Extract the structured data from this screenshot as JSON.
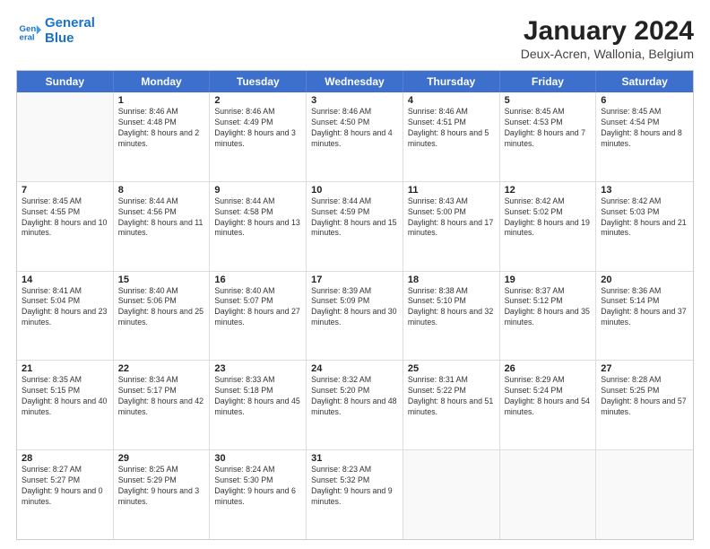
{
  "logo": {
    "line1": "General",
    "line2": "Blue"
  },
  "title": "January 2024",
  "subtitle": "Deux-Acren, Wallonia, Belgium",
  "header_days": [
    "Sunday",
    "Monday",
    "Tuesday",
    "Wednesday",
    "Thursday",
    "Friday",
    "Saturday"
  ],
  "rows": [
    [
      {
        "num": "",
        "sunrise": "",
        "sunset": "",
        "daylight": ""
      },
      {
        "num": "1",
        "sunrise": "Sunrise: 8:46 AM",
        "sunset": "Sunset: 4:48 PM",
        "daylight": "Daylight: 8 hours and 2 minutes."
      },
      {
        "num": "2",
        "sunrise": "Sunrise: 8:46 AM",
        "sunset": "Sunset: 4:49 PM",
        "daylight": "Daylight: 8 hours and 3 minutes."
      },
      {
        "num": "3",
        "sunrise": "Sunrise: 8:46 AM",
        "sunset": "Sunset: 4:50 PM",
        "daylight": "Daylight: 8 hours and 4 minutes."
      },
      {
        "num": "4",
        "sunrise": "Sunrise: 8:46 AM",
        "sunset": "Sunset: 4:51 PM",
        "daylight": "Daylight: 8 hours and 5 minutes."
      },
      {
        "num": "5",
        "sunrise": "Sunrise: 8:45 AM",
        "sunset": "Sunset: 4:53 PM",
        "daylight": "Daylight: 8 hours and 7 minutes."
      },
      {
        "num": "6",
        "sunrise": "Sunrise: 8:45 AM",
        "sunset": "Sunset: 4:54 PM",
        "daylight": "Daylight: 8 hours and 8 minutes."
      }
    ],
    [
      {
        "num": "7",
        "sunrise": "Sunrise: 8:45 AM",
        "sunset": "Sunset: 4:55 PM",
        "daylight": "Daylight: 8 hours and 10 minutes."
      },
      {
        "num": "8",
        "sunrise": "Sunrise: 8:44 AM",
        "sunset": "Sunset: 4:56 PM",
        "daylight": "Daylight: 8 hours and 11 minutes."
      },
      {
        "num": "9",
        "sunrise": "Sunrise: 8:44 AM",
        "sunset": "Sunset: 4:58 PM",
        "daylight": "Daylight: 8 hours and 13 minutes."
      },
      {
        "num": "10",
        "sunrise": "Sunrise: 8:44 AM",
        "sunset": "Sunset: 4:59 PM",
        "daylight": "Daylight: 8 hours and 15 minutes."
      },
      {
        "num": "11",
        "sunrise": "Sunrise: 8:43 AM",
        "sunset": "Sunset: 5:00 PM",
        "daylight": "Daylight: 8 hours and 17 minutes."
      },
      {
        "num": "12",
        "sunrise": "Sunrise: 8:42 AM",
        "sunset": "Sunset: 5:02 PM",
        "daylight": "Daylight: 8 hours and 19 minutes."
      },
      {
        "num": "13",
        "sunrise": "Sunrise: 8:42 AM",
        "sunset": "Sunset: 5:03 PM",
        "daylight": "Daylight: 8 hours and 21 minutes."
      }
    ],
    [
      {
        "num": "14",
        "sunrise": "Sunrise: 8:41 AM",
        "sunset": "Sunset: 5:04 PM",
        "daylight": "Daylight: 8 hours and 23 minutes."
      },
      {
        "num": "15",
        "sunrise": "Sunrise: 8:40 AM",
        "sunset": "Sunset: 5:06 PM",
        "daylight": "Daylight: 8 hours and 25 minutes."
      },
      {
        "num": "16",
        "sunrise": "Sunrise: 8:40 AM",
        "sunset": "Sunset: 5:07 PM",
        "daylight": "Daylight: 8 hours and 27 minutes."
      },
      {
        "num": "17",
        "sunrise": "Sunrise: 8:39 AM",
        "sunset": "Sunset: 5:09 PM",
        "daylight": "Daylight: 8 hours and 30 minutes."
      },
      {
        "num": "18",
        "sunrise": "Sunrise: 8:38 AM",
        "sunset": "Sunset: 5:10 PM",
        "daylight": "Daylight: 8 hours and 32 minutes."
      },
      {
        "num": "19",
        "sunrise": "Sunrise: 8:37 AM",
        "sunset": "Sunset: 5:12 PM",
        "daylight": "Daylight: 8 hours and 35 minutes."
      },
      {
        "num": "20",
        "sunrise": "Sunrise: 8:36 AM",
        "sunset": "Sunset: 5:14 PM",
        "daylight": "Daylight: 8 hours and 37 minutes."
      }
    ],
    [
      {
        "num": "21",
        "sunrise": "Sunrise: 8:35 AM",
        "sunset": "Sunset: 5:15 PM",
        "daylight": "Daylight: 8 hours and 40 minutes."
      },
      {
        "num": "22",
        "sunrise": "Sunrise: 8:34 AM",
        "sunset": "Sunset: 5:17 PM",
        "daylight": "Daylight: 8 hours and 42 minutes."
      },
      {
        "num": "23",
        "sunrise": "Sunrise: 8:33 AM",
        "sunset": "Sunset: 5:18 PM",
        "daylight": "Daylight: 8 hours and 45 minutes."
      },
      {
        "num": "24",
        "sunrise": "Sunrise: 8:32 AM",
        "sunset": "Sunset: 5:20 PM",
        "daylight": "Daylight: 8 hours and 48 minutes."
      },
      {
        "num": "25",
        "sunrise": "Sunrise: 8:31 AM",
        "sunset": "Sunset: 5:22 PM",
        "daylight": "Daylight: 8 hours and 51 minutes."
      },
      {
        "num": "26",
        "sunrise": "Sunrise: 8:29 AM",
        "sunset": "Sunset: 5:24 PM",
        "daylight": "Daylight: 8 hours and 54 minutes."
      },
      {
        "num": "27",
        "sunrise": "Sunrise: 8:28 AM",
        "sunset": "Sunset: 5:25 PM",
        "daylight": "Daylight: 8 hours and 57 minutes."
      }
    ],
    [
      {
        "num": "28",
        "sunrise": "Sunrise: 8:27 AM",
        "sunset": "Sunset: 5:27 PM",
        "daylight": "Daylight: 9 hours and 0 minutes."
      },
      {
        "num": "29",
        "sunrise": "Sunrise: 8:25 AM",
        "sunset": "Sunset: 5:29 PM",
        "daylight": "Daylight: 9 hours and 3 minutes."
      },
      {
        "num": "30",
        "sunrise": "Sunrise: 8:24 AM",
        "sunset": "Sunset: 5:30 PM",
        "daylight": "Daylight: 9 hours and 6 minutes."
      },
      {
        "num": "31",
        "sunrise": "Sunrise: 8:23 AM",
        "sunset": "Sunset: 5:32 PM",
        "daylight": "Daylight: 9 hours and 9 minutes."
      },
      {
        "num": "",
        "sunrise": "",
        "sunset": "",
        "daylight": ""
      },
      {
        "num": "",
        "sunrise": "",
        "sunset": "",
        "daylight": ""
      },
      {
        "num": "",
        "sunrise": "",
        "sunset": "",
        "daylight": ""
      }
    ]
  ]
}
